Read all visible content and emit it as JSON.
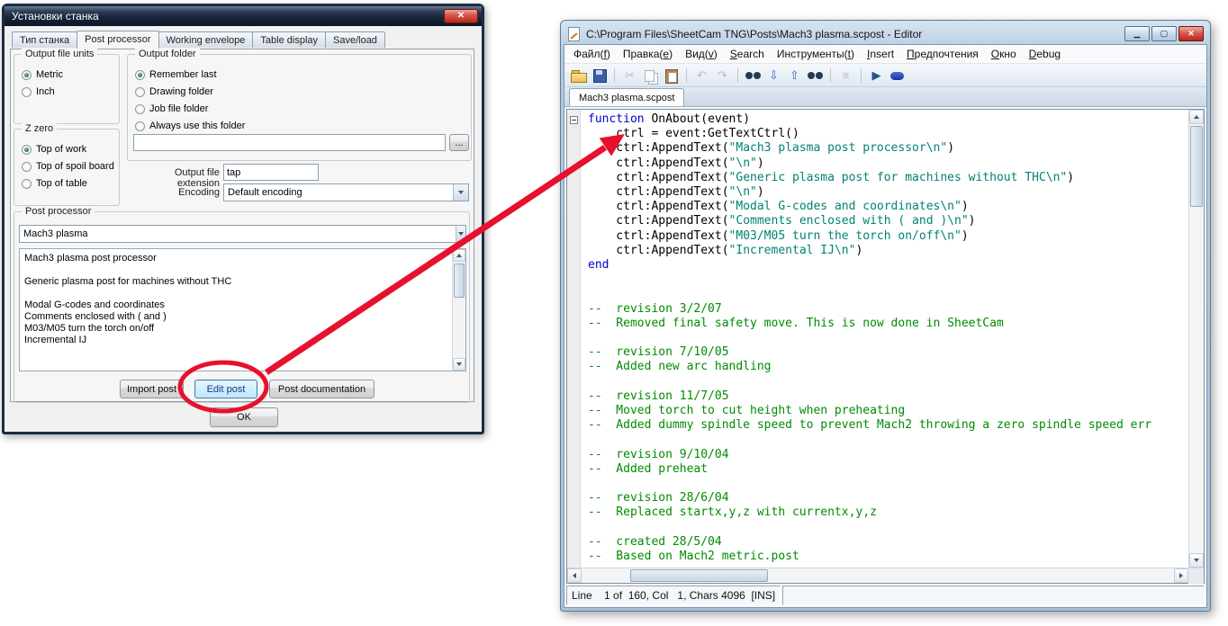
{
  "annotation": {
    "color": "#e8112d",
    "circled_button": "Edit post"
  },
  "dialog": {
    "title": "Установки станка",
    "close_glyph": "✕",
    "tabs": [
      "Тип станка",
      "Post processor",
      "Working envelope",
      "Table display",
      "Save/load"
    ],
    "active_tab_index": 1,
    "groups": {
      "units": {
        "legend": "Output file units",
        "options": [
          "Metric",
          "Inch"
        ],
        "selected": 0
      },
      "zzero": {
        "legend": "Z zero",
        "options": [
          "Top of work",
          "Top of spoil board",
          "Top of table"
        ],
        "selected": 0
      },
      "folder": {
        "legend": "Output folder",
        "options": [
          "Remember last",
          "Drawing folder",
          "Job file folder",
          "Always use this folder"
        ],
        "selected": 0
      }
    },
    "folder_path_value": "",
    "browse_button": "...",
    "extension": {
      "label": "Output file extension",
      "value": "tap"
    },
    "encoding": {
      "label": "Encoding",
      "value": "Default encoding"
    },
    "post": {
      "legend": "Post processor",
      "combo_value": "Mach3 plasma",
      "description": [
        "Mach3 plasma post processor",
        "",
        "Generic plasma post for machines without THC",
        "",
        "Modal G-codes and coordinates",
        "Comments enclosed with ( and )",
        "M03/M05 turn the torch on/off",
        "Incremental IJ"
      ]
    },
    "buttons": {
      "import": "Import post",
      "edit": "Edit post",
      "documentation": "Post documentation",
      "ok": "OK"
    }
  },
  "editor": {
    "title": "C:\\Program Files\\SheetCam TNG\\Posts\\Mach3 plasma.scpost - Editor",
    "window_buttons": [
      {
        "name": "minimize-button",
        "glyph": "▁"
      },
      {
        "name": "maximize-button",
        "glyph": "▢"
      },
      {
        "name": "close-button",
        "glyph": "✕",
        "style": "close"
      }
    ],
    "menus": [
      "Файл(f)",
      "Правка(e)",
      "Вид(v)",
      "Search",
      "Инструменты(t)",
      "Insert",
      "Предпочтения",
      "Окно",
      "Debug"
    ],
    "toolbar": [
      {
        "name": "open-icon",
        "shape": "folder"
      },
      {
        "name": "save-icon",
        "shape": "floppy"
      },
      {
        "sep": true
      },
      {
        "name": "cut-icon",
        "glyph": "✂",
        "dim": true
      },
      {
        "name": "copy-icon",
        "shape": "copyi",
        "dim": true
      },
      {
        "name": "paste-icon",
        "shape": "pastei"
      },
      {
        "sep": true
      },
      {
        "name": "undo-icon",
        "glyph": "↶",
        "dim": true
      },
      {
        "name": "redo-icon",
        "glyph": "↷",
        "dim": true
      },
      {
        "sep": true
      },
      {
        "name": "find-icon",
        "shape": "binoc"
      },
      {
        "name": "find-next-icon",
        "glyph": "⇩",
        "color": "#2b6cb5"
      },
      {
        "name": "find-previous-icon",
        "glyph": "⇧",
        "color": "#2b6cb5"
      },
      {
        "name": "find-in-files-icon",
        "shape": "binoc"
      },
      {
        "sep": true
      },
      {
        "name": "options-icon",
        "glyph": "≡",
        "dim": true
      },
      {
        "sep": true
      },
      {
        "name": "run-icon",
        "glyph": "▶",
        "color": "#28518e"
      },
      {
        "name": "breakpoint-icon",
        "shape": "pill"
      }
    ],
    "tab": "Mach3 plasma.scpost",
    "colors": {
      "keyword": "#0000c8",
      "string": "#008273",
      "comment": "#008c00"
    },
    "code": [
      [
        [
          "k",
          "function"
        ],
        [
          "p",
          " OnAbout(event)"
        ]
      ],
      [
        [
          "p",
          "    ctrl = event:GetTextCtrl()"
        ]
      ],
      [
        [
          "p",
          "    ctrl:AppendText("
        ],
        [
          "s",
          "\"Mach3 plasma post processor\\n\""
        ],
        [
          "p",
          ")"
        ]
      ],
      [
        [
          "p",
          "    ctrl:AppendText("
        ],
        [
          "s",
          "\"\\n\""
        ],
        [
          "p",
          ")"
        ]
      ],
      [
        [
          "p",
          "    ctrl:AppendText("
        ],
        [
          "s",
          "\"Generic plasma post for machines without THC\\n\""
        ],
        [
          "p",
          ")"
        ]
      ],
      [
        [
          "p",
          "    ctrl:AppendText("
        ],
        [
          "s",
          "\"\\n\""
        ],
        [
          "p",
          ")"
        ]
      ],
      [
        [
          "p",
          "    ctrl:AppendText("
        ],
        [
          "s",
          "\"Modal G-codes and coordinates\\n\""
        ],
        [
          "p",
          ")"
        ]
      ],
      [
        [
          "p",
          "    ctrl:AppendText("
        ],
        [
          "s",
          "\"Comments enclosed with ( and )\\n\""
        ],
        [
          "p",
          ")"
        ]
      ],
      [
        [
          "p",
          "    ctrl:AppendText("
        ],
        [
          "s",
          "\"M03/M05 turn the torch on/off\\n\""
        ],
        [
          "p",
          ")"
        ]
      ],
      [
        [
          "p",
          "    ctrl:AppendText("
        ],
        [
          "s",
          "\"Incremental IJ\\n\""
        ],
        [
          "p",
          ")"
        ]
      ],
      [
        [
          "k",
          "end"
        ]
      ],
      [],
      [],
      [
        [
          "c",
          "--  revision 3/2/07"
        ]
      ],
      [
        [
          "c",
          "--  Removed final safety move. This is now done in SheetCam"
        ]
      ],
      [],
      [
        [
          "c",
          "--  revision 7/10/05"
        ]
      ],
      [
        [
          "c",
          "--  Added new arc handling"
        ]
      ],
      [],
      [
        [
          "c",
          "--  revision 11/7/05"
        ]
      ],
      [
        [
          "c",
          "--  Moved torch to cut height when preheating"
        ]
      ],
      [
        [
          "c",
          "--  Added dummy spindle speed to prevent Mach2 throwing a zero spindle speed err"
        ]
      ],
      [],
      [
        [
          "c",
          "--  revision 9/10/04"
        ]
      ],
      [
        [
          "c",
          "--  Added preheat"
        ]
      ],
      [],
      [
        [
          "c",
          "--  revision 28/6/04"
        ]
      ],
      [
        [
          "c",
          "--  Replaced startx,y,z with currentx,y,z"
        ]
      ],
      [],
      [
        [
          "c",
          "--  created 28/5/04"
        ]
      ],
      [
        [
          "c",
          "--  Based on Mach2 metric.post"
        ]
      ]
    ],
    "status": "Line    1 of  160, Col   1, Chars 4096  [INS]"
  }
}
